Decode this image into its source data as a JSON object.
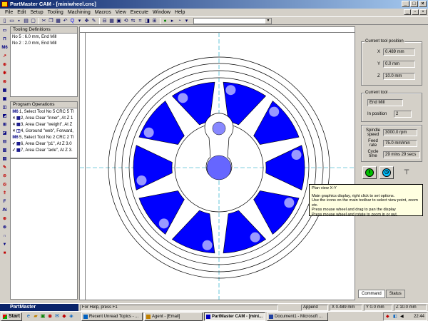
{
  "window": {
    "title": "PartMaster CAM - [miniwheel.cnc]"
  },
  "menu": [
    "File",
    "Edit",
    "Setup",
    "Tooling",
    "Machining",
    "Macros",
    "View",
    "Execute",
    "Window",
    "Help"
  ],
  "toolbar": {
    "buttons": [
      "new-icon",
      "open-icon",
      "save-icon",
      "print-icon",
      "preview-icon",
      "cut-icon",
      "copy-icon",
      "paste-icon",
      "undo-icon",
      "zoom-icon",
      "fit-icon",
      "pan-icon",
      "edit-icon",
      "view-icon",
      "grid-icon",
      "layer-icon",
      "rotate-icon",
      "flip-icon",
      "wire-icon",
      "solid-icon",
      "measure-icon",
      "info-icon",
      "play-icon",
      "step-icon",
      "point-icon"
    ],
    "combo_value": ""
  },
  "tooling": {
    "title": "Tooling Definitions",
    "items": [
      "No 5 : 6.0 mm, End Mill",
      "No 2 : 2.0 mm, End Mill"
    ]
  },
  "operations": {
    "title": "Program Operations",
    "items": [
      {
        "icon": "M6",
        "text": "1, Select Tool No 5 CRC 5 Tl"
      },
      {
        "icon": "×",
        "text": "2, Area Clear \"inner\", At Z 1"
      },
      {
        "icon": "×",
        "text": "3, Area Clear \"weight\", At Z"
      },
      {
        "icon": "×",
        "text": "4, Goround \"web\", Forward,"
      },
      {
        "icon": "M6",
        "text": "5, Select Tool No 2 CRC 2 Tl"
      },
      {
        "icon": "✓",
        "text": "6, Area Clear \"p1\", At Z 3.0"
      },
      {
        "icon": "✓",
        "text": "7, Area Clear \"axle\", At Z 3."
      }
    ]
  },
  "tooltip": {
    "title": "Plan view  X-Y",
    "lines": [
      "Main graphics display, right click to set options.",
      "Use the icons on the main toolbar to select view point, zoom etc.",
      "Press mouse wheel and drag to pan the display",
      "Press mouse wheel and rotate to zoom in or out."
    ]
  },
  "right_panel": {
    "tool_position": {
      "title": "Current tool position",
      "x_label": "X",
      "x": "0.489 mm",
      "y_label": "Y",
      "y": "0.0 mm",
      "z_label": "Z",
      "z": "10.0 mm"
    },
    "current_tool": {
      "title": "Current tool",
      "name": "End Mill",
      "in_position_label": "In position",
      "in_position": "2"
    },
    "spindle": {
      "label": "Spindle speed",
      "value": "3000.0 rpm"
    },
    "feed": {
      "label": "Feed rate",
      "value": "75.0 mm/min"
    },
    "cycle": {
      "label": "Cycle time",
      "value": "29 mins 29 secs"
    },
    "tabs": [
      "Command",
      "Status"
    ]
  },
  "statusbar": {
    "help": "For Help, press F1",
    "mode": "Append",
    "x": "X  0.489 mm",
    "y": "Y  0.0 mm",
    "z": "Z  10.0 mm"
  },
  "brand": "PartMaster",
  "taskbar": {
    "start": "Start",
    "tasks": [
      {
        "label": "Recent Unread Topics - ...",
        "active": false
      },
      {
        "label": "Agent - [Email]",
        "active": false
      },
      {
        "label": "PartMaster CAM - [mini...",
        "active": true
      },
      {
        "label": "Document1 - Microsoft ...",
        "active": false
      }
    ],
    "clock": "22:44"
  },
  "colors": {
    "accent": "#0000ff",
    "titlebar": "#0a246a",
    "tooltip_bg": "#ffffe1"
  }
}
